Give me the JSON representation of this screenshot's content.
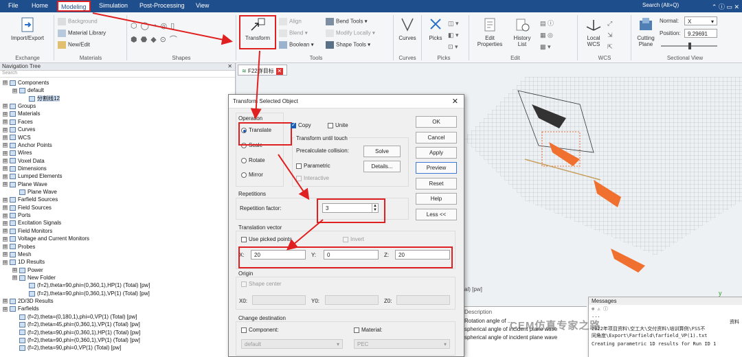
{
  "menu": [
    "File",
    "Home",
    "Modeling",
    "Simulation",
    "Post-Processing",
    "View"
  ],
  "search_placeholder": "Search (Alt+Q)",
  "ribbon": {
    "exchange": {
      "btn": "Import/Export",
      "group": "Exchange"
    },
    "materials": {
      "background": "Background",
      "library": "Material Library",
      "newedit": "New/Edit",
      "group": "Materials"
    },
    "shapes_group": "Shapes",
    "tools": {
      "transform": "Transform",
      "align": "Align",
      "blend": "Blend",
      "boolean": "Boolean",
      "bend": "Bend Tools",
      "modify": "Modify Locally",
      "shape": "Shape Tools",
      "group": "Tools"
    },
    "curves": {
      "btn": "Curves",
      "group": "Curves"
    },
    "picks": {
      "btn": "Picks",
      "group": "Picks"
    },
    "edit": {
      "props": "Edit\nProperties",
      "history": "History\nList",
      "group": "Edit"
    },
    "wcs": {
      "btn": "Local\nWCS",
      "group": "WCS"
    },
    "sectional": {
      "cutting": "Cutting\nPlane",
      "normal_label": "Normal:",
      "normal_value": "X",
      "position_label": "Position:",
      "position_value": "9.29691",
      "group": "Sectional View"
    }
  },
  "nav": {
    "title": "Navigation Tree",
    "search": "Search",
    "items": [
      "Components",
      "default",
      "分割线12",
      "Groups",
      "Materials",
      "Faces",
      "Curves",
      "WCS",
      "Anchor Points",
      "Wires",
      "Voxel Data",
      "Dimensions",
      "Lumped Elements",
      "Plane Wave",
      "Plane Wave",
      "Farfield Sources",
      "Field Sources",
      "Ports",
      "Excitation Signals",
      "Field Monitors",
      "Voltage and Current Monitors",
      "Probes",
      "Mesh",
      "1D Results",
      "Power",
      "New Folder",
      "(f=2),theta=90,phi=(0,360,1),HP(1) (Total) [pw]",
      "(f=2),theta=90,phi=(0,360,1),VP(1) (Total) [pw]",
      "2D/3D Results",
      "Farfields",
      "(f=2),theta=(0,180,1),phi=0,VP(1) (Total) [pw]",
      "(f=2),theta=45,phi=(0,360,1),VP(1) (Total) [pw]",
      "(f=2),theta=90,phi=(0,360,1),HP(1) (Total) [pw]",
      "(f=2),theta=90,phi=(0,360,1),VP(1) (Total) [pw]",
      "(f=2),theta=90,phi=0,VP(1) (Total) [pw]"
    ]
  },
  "viewport_tab": "F22群目标",
  "dialog": {
    "title": "Transform Selected Object",
    "operation": "Operation",
    "translate": "Translate",
    "scale": "Scale",
    "rotate": "Rotate",
    "mirror": "Mirror",
    "copy": "Copy",
    "unite": "Unite",
    "until_touch": "Transform until touch",
    "precalc": "Precalculate collision:",
    "solve": "Solve",
    "parametric": "Parametric",
    "details": "Details...",
    "interactive": "Interactive",
    "repetitions": "Repetitions",
    "rep_factor": "Repetition factor:",
    "rep_value": "3",
    "translation": "Translation vector",
    "use_picked": "Use picked points",
    "invert": "Invert",
    "x_label": "X:",
    "x_value": "20",
    "y_label": "Y:",
    "y_value": "0",
    "z_label": "Z:",
    "z_value": "20",
    "origin": "Origin",
    "shape_center": "Shape center",
    "x0": "X0:",
    "y0": "Y0:",
    "z0": "Z0:",
    "change_dest": "Change destination",
    "component": "Component:",
    "material": "Material:",
    "comp_value": "default",
    "mat_value": "PEC",
    "ok": "OK",
    "cancel": "Cancel",
    "apply": "Apply",
    "preview": "Preview",
    "reset": "Reset",
    "help": "Help",
    "less": "Less <<"
  },
  "params_panel": {
    "header": "Description",
    "rows": [
      "Rotation angle of ...",
      "spherical angle of incident plane wave",
      "spherical angle of incident plane wave"
    ],
    "left_stub": "al) [pw]"
  },
  "messages": {
    "title": "Messages",
    "lines": [
      "...",
      "资料",
      "2022年项目资料\\空工大\\交付资料\\培训算例\\FSS不",
      "同角度\\Export\\Farfield\\farfield_VP(1).txt",
      "Creating parametric 1D results for Run ID 1"
    ]
  },
  "watermark": "CEM仿真专家之路"
}
